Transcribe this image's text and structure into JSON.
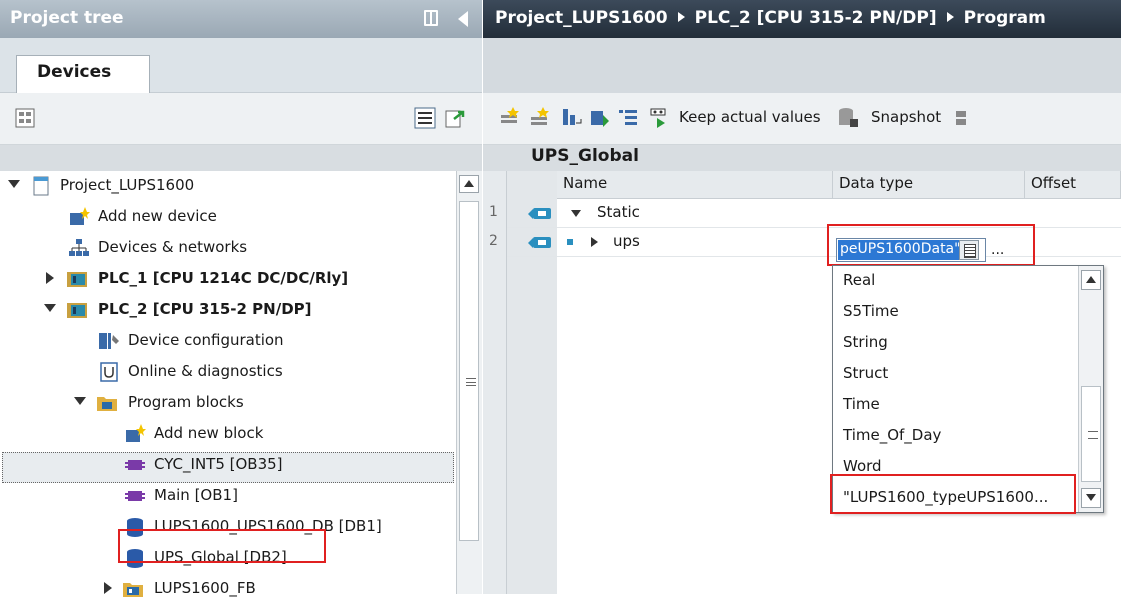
{
  "left_panel": {
    "title": "Project tree",
    "tab_label": "Devices",
    "tree": [
      {
        "label": "Project_LUPS1600",
        "expander": "down",
        "icon": "project-icon",
        "bold": false
      },
      {
        "label": "Add new device",
        "expander": "none",
        "icon": "add-device-icon",
        "bold": false
      },
      {
        "label": "Devices & networks",
        "expander": "none",
        "icon": "network-icon",
        "bold": false
      },
      {
        "label": "PLC_1 [CPU 1214C DC/DC/Rly]",
        "expander": "right",
        "icon": "plc-icon",
        "bold": true
      },
      {
        "label": "PLC_2 [CPU 315-2 PN/DP]",
        "expander": "down",
        "icon": "plc-icon",
        "bold": true
      },
      {
        "label": "Device configuration",
        "expander": "none",
        "icon": "device-config-icon",
        "bold": false
      },
      {
        "label": "Online & diagnostics",
        "expander": "none",
        "icon": "diagnostics-icon",
        "bold": false
      },
      {
        "label": "Program blocks",
        "expander": "down",
        "icon": "folder-icon",
        "bold": false
      },
      {
        "label": "Add new block",
        "expander": "none",
        "icon": "add-block-icon",
        "bold": false
      },
      {
        "label": "CYC_INT5 [OB35]",
        "expander": "none",
        "icon": "ob-icon",
        "bold": false
      },
      {
        "label": "Main [OB1]",
        "expander": "none",
        "icon": "ob-icon",
        "bold": false
      },
      {
        "label": "LUPS1600_UPS1600_DB [DB1]",
        "expander": "none",
        "icon": "db-icon",
        "bold": false
      },
      {
        "label": "UPS_Global [DB2]",
        "expander": "none",
        "icon": "db-icon",
        "bold": false
      },
      {
        "label": "LUPS1600_FB",
        "expander": "right",
        "icon": "fb-folder-icon",
        "bold": false
      }
    ]
  },
  "right_panel": {
    "breadcrumb": [
      "Project_LUPS1600",
      "PLC_2 [CPU 315-2 PN/DP]",
      "Program"
    ],
    "toolbar": {
      "keep_actual_values": "Keep actual values",
      "snapshot": "Snapshot"
    },
    "block_title": "UPS_Global",
    "columns": {
      "name": "Name",
      "data_type": "Data type",
      "offset": "Offset"
    },
    "rows": [
      {
        "num": "1",
        "name": "Static",
        "expander": "down"
      },
      {
        "num": "2",
        "name": "ups",
        "expander": "right"
      }
    ],
    "data_type_edit_value": "peUPS1600Data\"",
    "ellipsis": "...",
    "dropdown_options": [
      "Real",
      "S5Time",
      "String",
      "Struct",
      "Time",
      "Time_Of_Day",
      "Word",
      "\"LUPS1600_typeUPS1600..."
    ]
  },
  "colors": {
    "highlight_red": "#e02020",
    "selection_blue": "#2c78d4",
    "header_dark": "#222d39"
  }
}
